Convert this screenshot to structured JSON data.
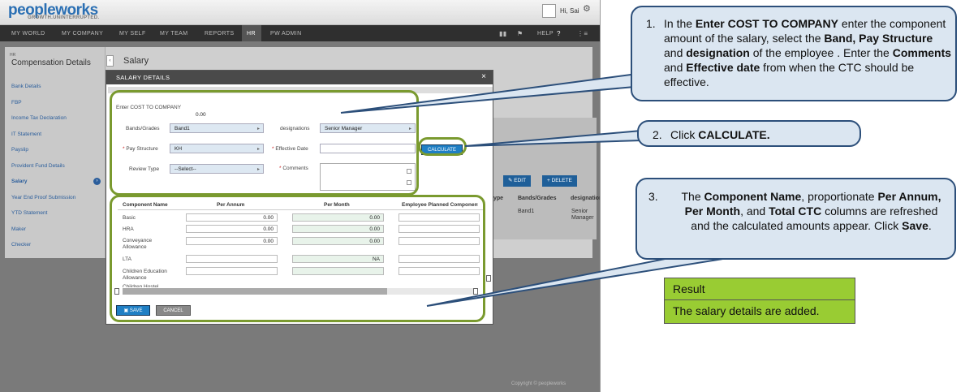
{
  "app": {
    "logo": "peopleworks",
    "logo_tagline": "GROWTH.UNINTERRUPTED.",
    "greeting": "Hi, Sai",
    "nav": [
      "MY WORLD",
      "MY COMPANY",
      "MY SELF",
      "MY TEAM",
      "REPORTS",
      "HR",
      "PW ADMIN"
    ],
    "help_label": "HELP",
    "footer": "Copyright ©   peopleworks"
  },
  "sidebar": {
    "section": "HR",
    "title": "Compensation Details",
    "collapse": "‹",
    "items": [
      "Bank Details",
      "FBP",
      "Income Tax Declaration",
      "IT Statement",
      "Payslip",
      "Provident Fund Details",
      "Salary",
      "Year End Proof Submission",
      "YTD Statement",
      "Maker",
      "Checker"
    ]
  },
  "page": {
    "title": "Salary",
    "edit_label": "EDIT",
    "delete_label": "DELETE",
    "bg_headers": [
      "ype",
      "Bands/Grades",
      "designation"
    ],
    "bg_row": [
      "Band1",
      "Senior",
      "Manager"
    ]
  },
  "modal": {
    "title": "SALARY DETAILS",
    "close": "×",
    "ctc_label": "Enter COST TO COMPANY",
    "ctc_value": "0.00",
    "bands_label": "Bands/Grades",
    "bands_value": "Band1",
    "designations_label": "designations",
    "designations_value": "Senior Manager",
    "pay_structure_label": "Pay Structure",
    "pay_structure_value": "KH",
    "effective_date_label": "Effective Date",
    "calculate_label": "CALCULATE",
    "review_type_label": "Review Type",
    "review_type_value": "--Select--",
    "comments_label": "Comments",
    "columns": [
      "Component Name",
      "Per Annum",
      "Per Month",
      "Employee Planned Component"
    ],
    "rows": [
      {
        "name": "Basic",
        "annum": "0.00",
        "month": "0.00"
      },
      {
        "name": "HRA",
        "annum": "0.00",
        "month": "0.00"
      },
      {
        "name": "Conveyance Allowance",
        "annum": "0.00",
        "month": "0.00"
      },
      {
        "name": "LTA",
        "annum": "",
        "month": "NA"
      },
      {
        "name": "Children Education Allowance",
        "annum": "",
        "month": ""
      },
      {
        "name": "Children Hostel",
        "annum": "",
        "month": ""
      }
    ],
    "save_label": "SAVE",
    "cancel_label": "CANCEL"
  },
  "callouts": [
    {
      "num": "1.",
      "parts": [
        {
          "t": "In the "
        },
        {
          "t": "Enter COST TO COMPANY",
          "b": true
        },
        {
          "t": " enter the component amount of the salary, select the "
        },
        {
          "t": "Band, Pay Structure",
          "b": true
        },
        {
          "t": " and "
        },
        {
          "t": "designation",
          "b": true
        },
        {
          "t": " of the employee . Enter the "
        },
        {
          "t": "Comments",
          "b": true
        },
        {
          "t": " and "
        },
        {
          "t": "Effective date",
          "b": true
        },
        {
          "t": " from when the CTC should be effective."
        }
      ]
    },
    {
      "num": "2.",
      "parts": [
        {
          "t": "Click "
        },
        {
          "t": "CALCULATE.",
          "b": true
        }
      ]
    },
    {
      "num": "3.",
      "parts": [
        {
          "t": "The "
        },
        {
          "t": "Component Name",
          "b": true
        },
        {
          "t": ", proportionate "
        },
        {
          "t": "Per Annum, Per Month",
          "b": true
        },
        {
          "t": ", and "
        },
        {
          "t": "Total CTC",
          "b": true
        },
        {
          "t": " columns are refreshed and the calculated amounts appear. Click "
        },
        {
          "t": "Save",
          "b": true
        },
        {
          "t": "."
        }
      ]
    }
  ],
  "result": {
    "title": "Result",
    "text": "The salary details are added."
  },
  "colors": {
    "highlight": "#7a9a2f",
    "callout_fill": "#dbe6f1",
    "callout_border": "#2c4f7a",
    "result": "#99cc33",
    "primary": "#1f7fc4"
  }
}
